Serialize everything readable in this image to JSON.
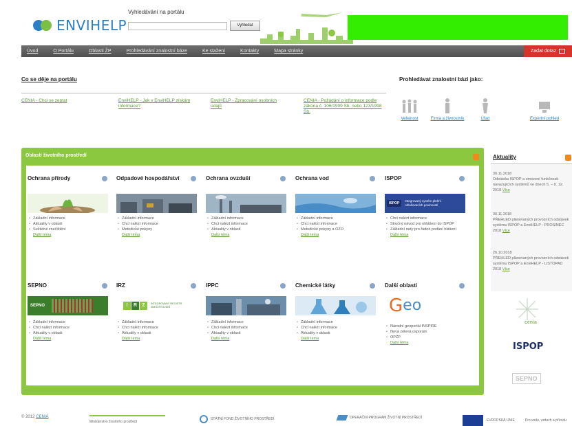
{
  "header": {
    "logo_text": "ENVIHELP",
    "search_label": "Vyhledávání na portálu",
    "search_placeholder": "",
    "search_button": "Vyhledat"
  },
  "nav": {
    "items": [
      "Úvod",
      "O Portálu",
      "Oblasti ŽP",
      "Prohledávání znalostní báze",
      "Ke stažení",
      "Kontakty",
      "Mapa stránky"
    ],
    "cta": "Zadat dotaz"
  },
  "portal": {
    "title": "Co se děje na portálu",
    "links": [
      "CENIA - Chci se zeptat",
      "EnviHELP - Jak v EnviHELP získám informace?",
      "EnviHELP - Zpracování osobních údajů",
      "CENIA - Požádání o informace podle zákona č. 106/1999 Sb. nebo 123/1998 Sb."
    ]
  },
  "knowledge_base": {
    "title": "Prohledávat znalostní bázi jako:",
    "items": [
      "Veřejnost",
      "Firma a živnostník",
      "Úřad",
      "Expertní pohled"
    ]
  },
  "areas": {
    "title": "Oblasti životního prostředí",
    "cards": [
      {
        "title": "Ochrana přírody",
        "items": [
          "Základní informace",
          "Aktuality v oblasti",
          "Světelné znečištění"
        ],
        "more": "Další téma"
      },
      {
        "title": "Odpadové hospodářství",
        "items": [
          "Základní informace",
          "Chci nalézt informace",
          "Metodické pokyny"
        ],
        "more": "Další téma"
      },
      {
        "title": "Ochrana ovzduší",
        "items": [
          "Základní informace",
          "Chci nalézt informace",
          "Aktuality v oblasti"
        ],
        "more": "Další téma"
      },
      {
        "title": "Ochrana vod",
        "items": [
          "Základní informace",
          "Chci nalézt informace",
          "Metodické pokyny a OZO"
        ],
        "more": "Další téma"
      },
      {
        "title": "ISPOP",
        "banner": "Integrovaný systém plnění ohlašovacích povinností",
        "items": [
          "Chci nalézt informace",
          "Stručný návod pro ohlášení do ISPOP",
          "Základní rady pro řádné podání hlášení"
        ],
        "more": "Další téma"
      },
      {
        "title": "SEPNO",
        "items": [
          "Základní informace",
          "Chci nalézt informace",
          "Aktuality v oblasti"
        ],
        "more": "Další téma"
      },
      {
        "title": "IRZ",
        "banner": "INTEGROVANÝ REGISTR ZNEČIŠŤOVÁNÍ",
        "items": [
          "Základní informace",
          "Chci nalézt informace",
          "Aktuality v oblasti"
        ],
        "more": "Další téma"
      },
      {
        "title": "IPPC",
        "items": [
          "Základní informace",
          "Chci nalézt informace",
          "Aktuality v oblasti"
        ],
        "more": "Další téma"
      },
      {
        "title": "Chemické látky",
        "items": [
          "Základní informace",
          "Chci nalézt informace",
          "Aktuality v oblasti"
        ],
        "more": "Další téma"
      },
      {
        "title": "Další oblasti",
        "items": [
          "Národní geoportál INSPIRE",
          "Nová zelená úsporám",
          "OPŽP"
        ],
        "more": "Další téma"
      }
    ]
  },
  "news": {
    "title": "Aktuality",
    "items": [
      {
        "date": "30.11.2018",
        "text": "Odstávka ISPOP a omezení funkčnosti navazujících systémů ve dnech 5. – 9. 12. 2018",
        "more": "Více"
      },
      {
        "date": "30.11.2018",
        "text": "PŘEHLED plánovaných provozních odstávek systému ISPOP a EnviHELP - PROSINEC 2018",
        "more": "Více"
      },
      {
        "date": "26.10.2018",
        "text": "PŘEHLED plánovaných provozních odstávek systému ISPOP a EnviHELP - LISTOPAD 2018",
        "more": "Více"
      }
    ],
    "partners": [
      "cenia",
      "ISPOP",
      "SEPNO"
    ]
  },
  "footer": {
    "copyright": "© 2012",
    "copyright_link": "CENIA",
    "logos": [
      "Ministerstvo životního prostředí",
      "STÁTNÍ FOND ŽIVOTNÍHO PROSTŘEDÍ",
      "OPERAČNÍ PROGRAM ŽIVOTNÍ PROSTŘEDÍ",
      "EVROPSKÁ UNIE",
      "Pro vodu, vzduch a přírodu"
    ]
  },
  "colors": {
    "brand_green": "#8cc83f",
    "brand_blue": "#2a7fc6",
    "nav_gray": "#5a5a5a",
    "cta_red": "#d8332b",
    "banner_green": "#33ee00"
  }
}
